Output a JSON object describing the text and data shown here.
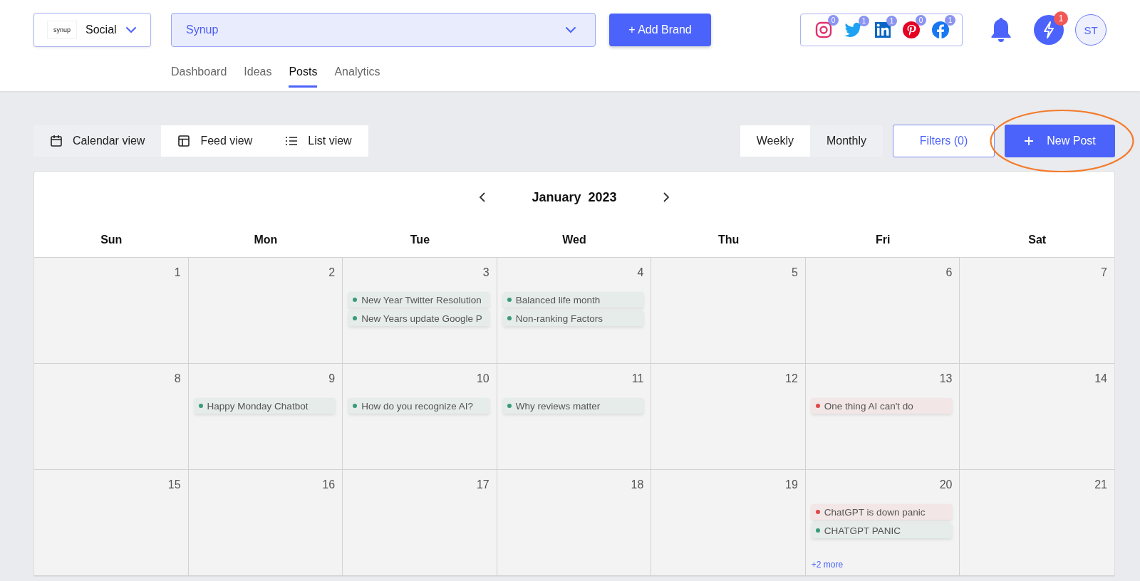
{
  "workspace": {
    "logo_text": "synup",
    "label": "Social"
  },
  "brand_select": {
    "value": "Synup"
  },
  "add_brand": "+ Add Brand",
  "social_counts": [
    {
      "kind": "instagram",
      "count": "0"
    },
    {
      "kind": "twitter",
      "count": "1"
    },
    {
      "kind": "linkedin",
      "count": "1"
    },
    {
      "kind": "pinterest",
      "count": "0"
    },
    {
      "kind": "facebook",
      "count": "1"
    }
  ],
  "activity_badge": "1",
  "avatar": "ST",
  "nav_tabs": [
    {
      "label": "Dashboard",
      "selected": false
    },
    {
      "label": "Ideas",
      "selected": false
    },
    {
      "label": "Posts",
      "selected": true
    },
    {
      "label": "Analytics",
      "selected": false
    }
  ],
  "view_tabs": [
    {
      "kind": "calendar",
      "label": "Calendar view",
      "selected": true
    },
    {
      "kind": "feed",
      "label": "Feed view",
      "selected": false
    },
    {
      "kind": "list",
      "label": "List view",
      "selected": false
    }
  ],
  "period_tabs": [
    {
      "label": "Weekly",
      "selected": false
    },
    {
      "label": "Monthly",
      "selected": true
    }
  ],
  "filters": "Filters (0)",
  "new_post": "New Post",
  "calendar": {
    "title": "January  2023",
    "weekdays": [
      "Sun",
      "Mon",
      "Tue",
      "Wed",
      "Thu",
      "Fri",
      "Sat"
    ],
    "weeks": [
      [
        {
          "day": "1"
        },
        {
          "day": "2"
        },
        {
          "day": "3",
          "posts": [
            {
              "title": "New Year Twitter Resolution",
              "color": "#3a9a7a"
            },
            {
              "title": "New Years update Google P",
              "color": "#3a9a7a"
            }
          ]
        },
        {
          "day": "4",
          "posts": [
            {
              "title": "Balanced life month",
              "color": "#3a9a7a"
            },
            {
              "title": "Non-ranking Factors",
              "color": "#3a9a7a"
            }
          ]
        },
        {
          "day": "5"
        },
        {
          "day": "6"
        },
        {
          "day": "7"
        }
      ],
      [
        {
          "day": "8"
        },
        {
          "day": "9",
          "posts": [
            {
              "title": "Happy Monday Chatbot",
              "color": "#3a9a7a"
            }
          ]
        },
        {
          "day": "10",
          "posts": [
            {
              "title": "How do you recognize AI?",
              "color": "#3a9a7a"
            }
          ]
        },
        {
          "day": "11",
          "posts": [
            {
              "title": "Why reviews matter",
              "color": "#3a9a7a"
            }
          ]
        },
        {
          "day": "12"
        },
        {
          "day": "13",
          "posts": [
            {
              "title": "One thing AI can't do",
              "color": "#e04848"
            }
          ]
        },
        {
          "day": "14"
        }
      ],
      [
        {
          "day": "15"
        },
        {
          "day": "16"
        },
        {
          "day": "17"
        },
        {
          "day": "18"
        },
        {
          "day": "19"
        },
        {
          "day": "20",
          "posts": [
            {
              "title": "ChatGPT is down panic",
              "color": "#e04848"
            },
            {
              "title": "CHATGPT PANIC",
              "color": "#3a9a7a"
            }
          ],
          "more": "+2 more"
        },
        {
          "day": "21"
        }
      ]
    ]
  }
}
